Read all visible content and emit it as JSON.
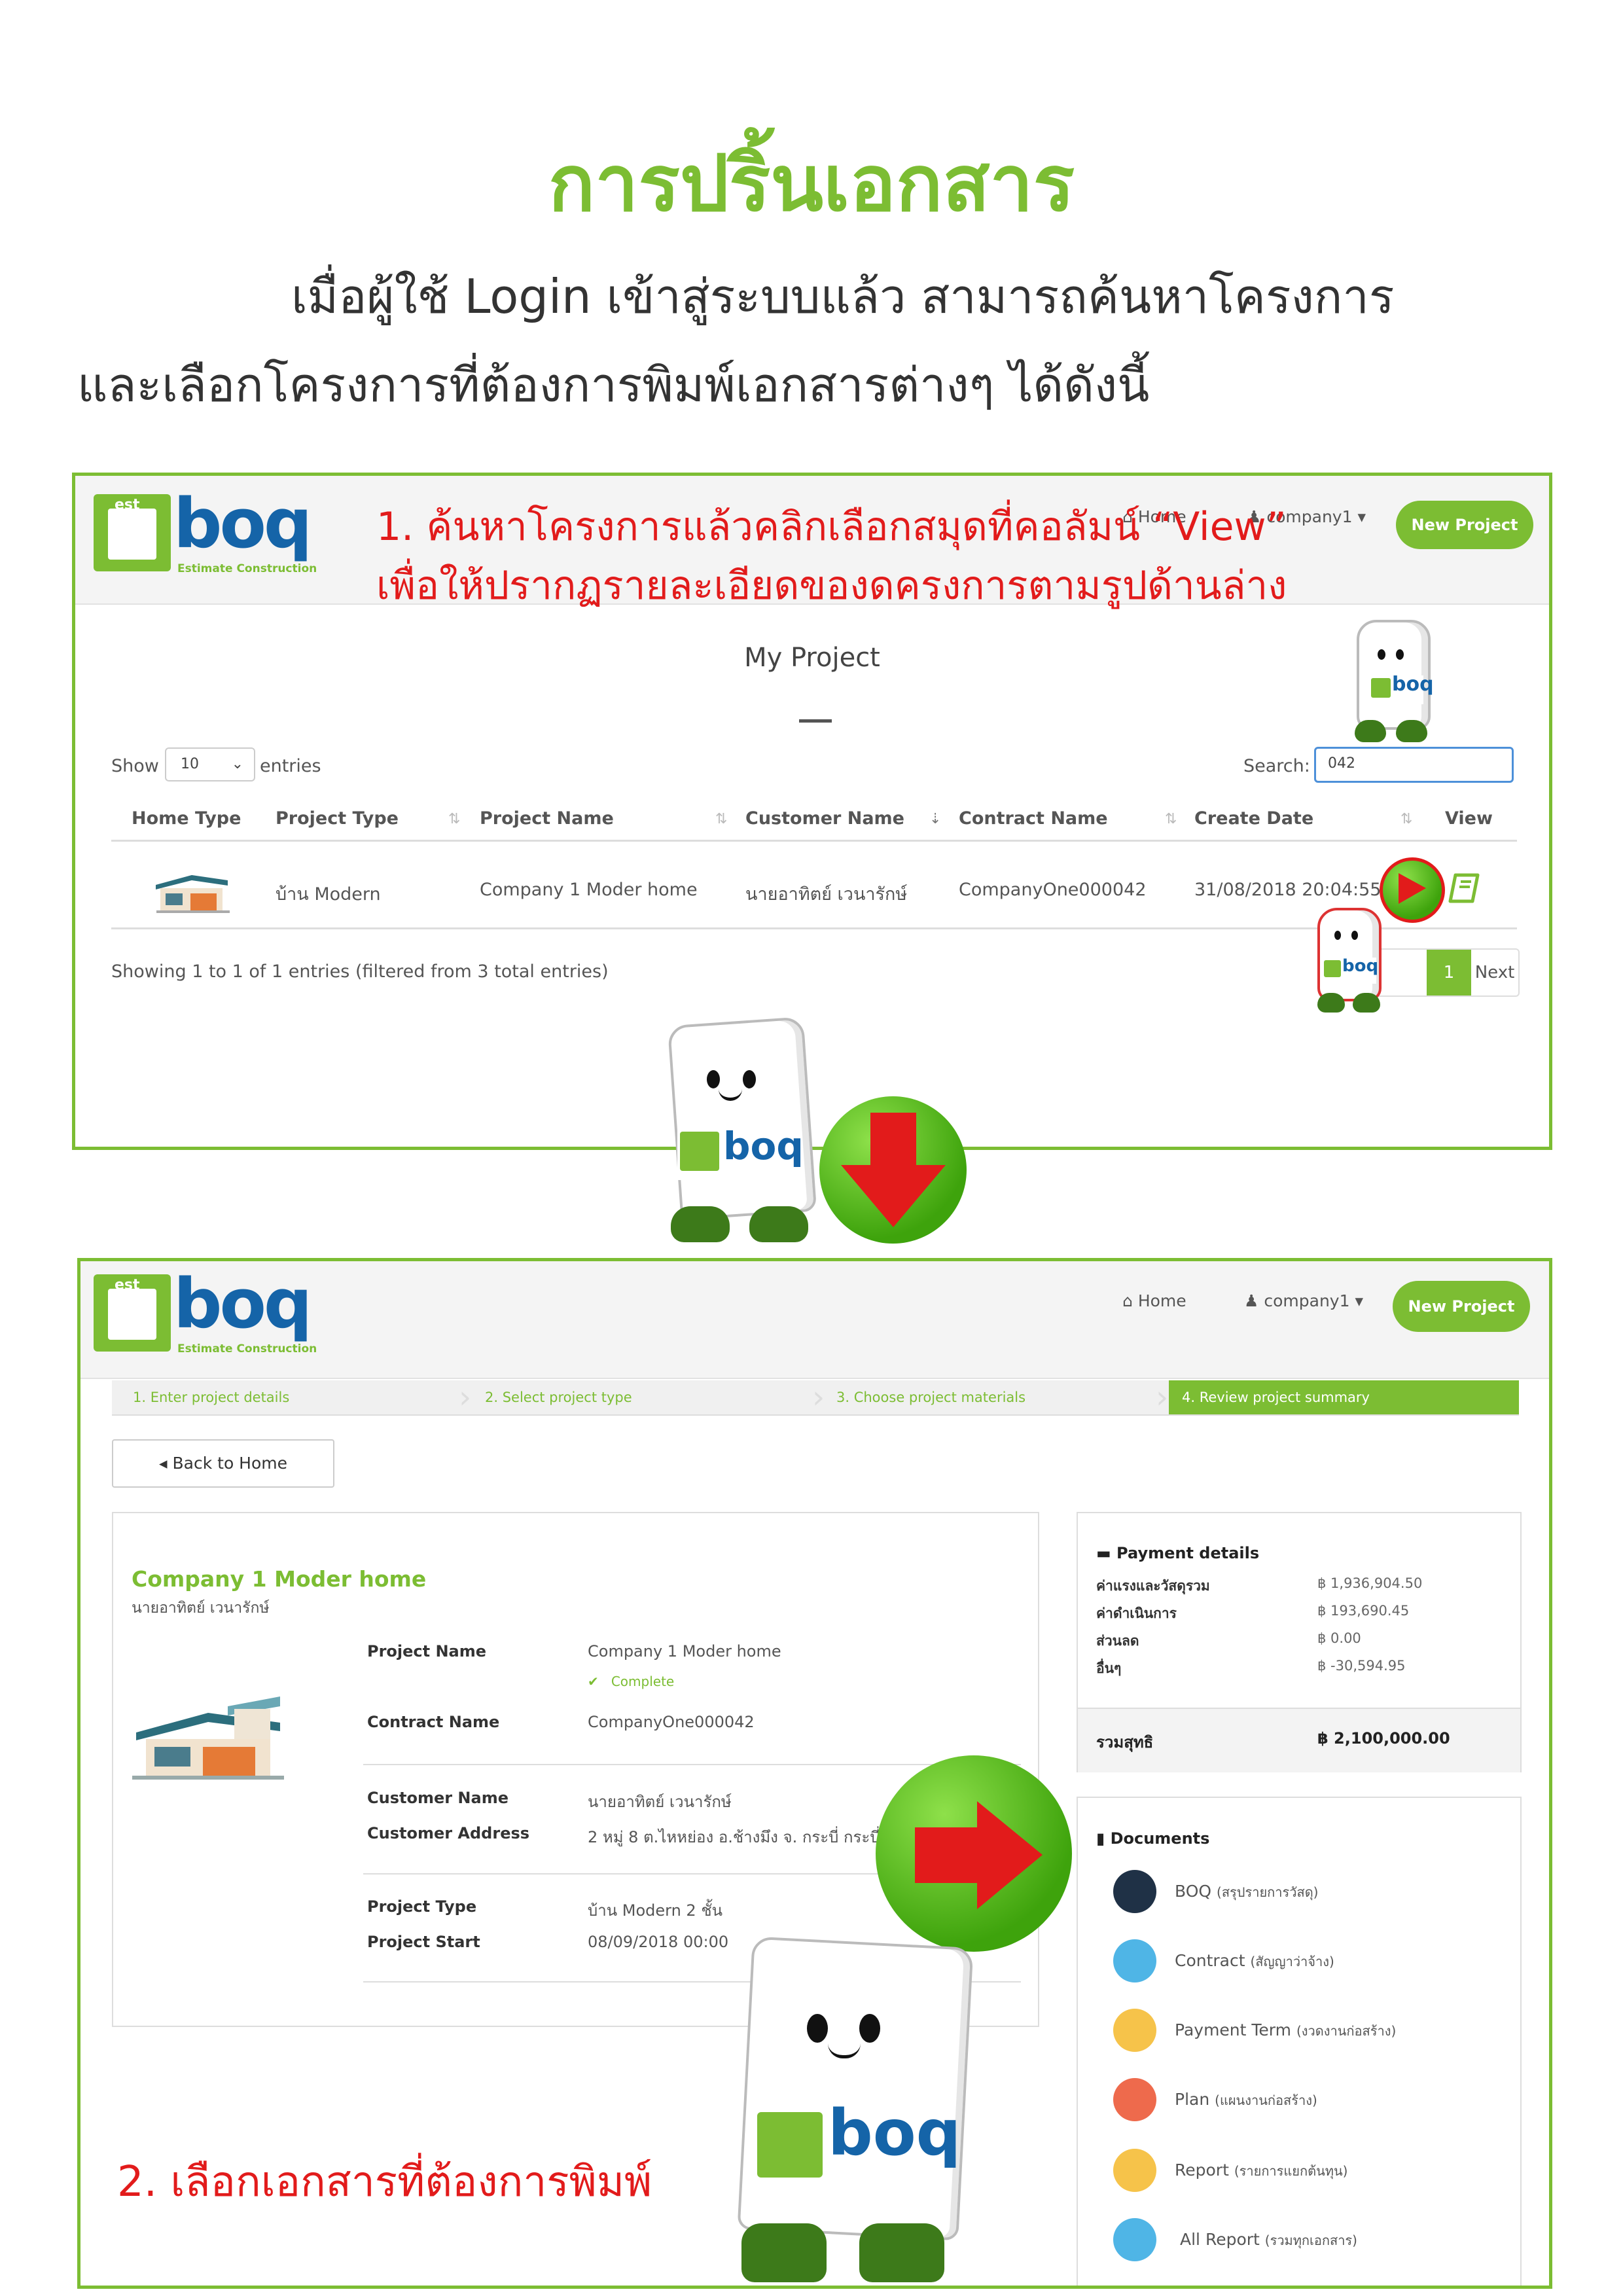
{
  "doc": {
    "title": "การปริ้นเอกสาร",
    "intro_line1": "เมื่อผู้ใช้ Login เข้าสู่ระบบแล้ว สามารถค้นหาโครงการ",
    "intro_line2": "และเลือกโครงการที่ต้องการพิมพ์เอกสารต่างๆ ได้ดังนี้"
  },
  "brand": {
    "logo_letters": "est",
    "logo_name": "boq",
    "logo_tagline": "Estimate Construction"
  },
  "colors": {
    "brand_green": "#7cbd33",
    "brand_blue": "#1564a8",
    "annotation_red": "#e21b1b"
  },
  "screen1": {
    "annotation_line1": "1. ค้นหาโครงการแล้วคลิกเลือกสมุดที่คอลัมน์ “View”",
    "annotation_line2": "เพื่อให้ปรากฏรายละเอียดของดครงการตามรูปด้านล่าง",
    "nav_home": "Home",
    "nav_user": "company1",
    "new_project": "New Project",
    "page_title": "My Project",
    "show_label": "Show",
    "entries_value": "10",
    "entries_label": "entries",
    "search_label": "Search:",
    "search_value": "042",
    "columns": [
      "Home Type",
      "Project Type",
      "Project Name",
      "Customer Name",
      "Contract Name",
      "Create Date",
      "View"
    ],
    "row": {
      "project_type": "บ้าน Modern",
      "project_name": "Company 1 Moder home",
      "customer_name": "นายอาทิตย์ เวนารักษ์",
      "contract_name": "CompanyOne000042",
      "create_date": "31/08/2018 20:04:55"
    },
    "info": "Showing 1 to 1 of 1 entries (filtered from 3 total entries)",
    "page_current": "1",
    "page_next": "Next"
  },
  "screen2": {
    "nav_home": "Home",
    "nav_user": "company1",
    "new_project": "New Project",
    "steps": [
      "1. Enter project details",
      "2. Select project type",
      "3. Choose project materials",
      "4. Review project summary"
    ],
    "back_button": "Back to Home",
    "project_title": "Company 1 Moder home",
    "project_owner": "นายอาทิตย์ เวนารักษ์",
    "fields": {
      "project_name_label": "Project Name",
      "project_name_value": "Company 1 Moder home",
      "status": "Complete",
      "contract_name_label": "Contract Name",
      "contract_name_value": "CompanyOne000042",
      "customer_name_label": "Customer Name",
      "customer_name_value": "นายอาทิตย์ เวนารักษ์",
      "customer_address_label": "Customer Address",
      "customer_address_value": "2 หมู่ 8 ต.ไหหย่อง อ.ช้างมึง จ. กระบี่ กระบี่",
      "project_type_label": "Project Type",
      "project_type_value": "บ้าน Modern 2 ชั้น",
      "project_start_label": "Project Start",
      "project_start_value": "08/09/2018 00:00"
    },
    "payment": {
      "heading": "Payment details",
      "rows": [
        {
          "label": "ค่าแรงและวัสดุรวม",
          "value": "฿ 1,936,904.50"
        },
        {
          "label": "ค่าดำเนินการ",
          "value": "฿ 193,690.45"
        },
        {
          "label": "ส่วนลด",
          "value": "฿ 0.00"
        },
        {
          "label": "อื่นๆ",
          "value": "฿ -30,594.95"
        }
      ],
      "total_label": "รวมสุทธิ",
      "total_value": "฿ 2,100,000.00"
    },
    "documents": {
      "heading": "Documents",
      "items": [
        {
          "label": "BOQ",
          "sub": "(สรุปรายการวัสดุ)",
          "color": "#1f3146"
        },
        {
          "label": "Contract",
          "sub": "(สัญญาว่าจ้าง)",
          "color": "#4fb5e6"
        },
        {
          "label": "Payment Term",
          "sub": "(งวดงานก่อสร้าง)",
          "color": "#f6c34a"
        },
        {
          "label": "Plan",
          "sub": "(แผนงานก่อสร้าง)",
          "color": "#ee6a4c"
        },
        {
          "label": "Report",
          "sub": "(รายการแยกต้นทุน)",
          "color": "#f6c34a"
        },
        {
          "label": "All Report",
          "sub": "(รวมทุกเอกสาร)",
          "color": "#4fb5e6"
        }
      ]
    },
    "annotation": "2. เลือกเอกสารที่ต้องการพิมพ์"
  }
}
